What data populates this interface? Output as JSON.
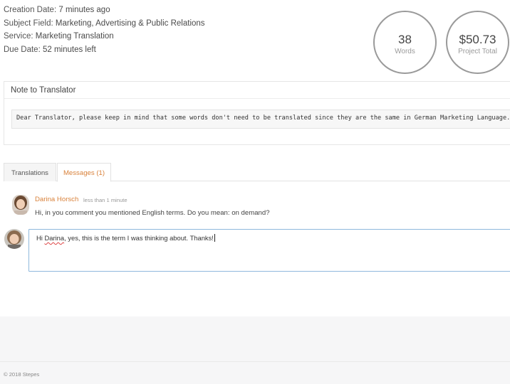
{
  "project_info": {
    "creation_date_label": "Creation Date:",
    "creation_date_value": "7 minutes ago",
    "subject_field_label": "Subject Field:",
    "subject_field_value": "Marketing, Advertising & Public Relations",
    "service_label": "Service:",
    "service_value": "Marketing Translation",
    "due_date_label": "Due Date:",
    "due_date_value": "52 minutes left"
  },
  "stats": {
    "words_value": "38",
    "words_label": "Words",
    "total_value": "$50.73",
    "total_label": "Project Total"
  },
  "note": {
    "title": "Note to Translator",
    "body": "Dear Translator, please keep in mind that some words don't need to be translated since they are the same in German Marketing Language."
  },
  "tabs": [
    {
      "label": "Translations",
      "active": false
    },
    {
      "label": "Messages (1)",
      "active": true
    }
  ],
  "message": {
    "author": "Darina Horsch",
    "time": "less than 1 minute",
    "text": "Hi, in you comment you mentioned English terms. Do you mean: on demand?"
  },
  "reply": {
    "text_before": "Hi ",
    "misspelled": "Darina",
    "text_after": ", yes, this is the term I was thinking about. Thanks!"
  },
  "footer": {
    "copyright": "© 2018 Stepes"
  },
  "colors": {
    "accent": "#d9823b",
    "input_border": "#8fb8dc"
  }
}
